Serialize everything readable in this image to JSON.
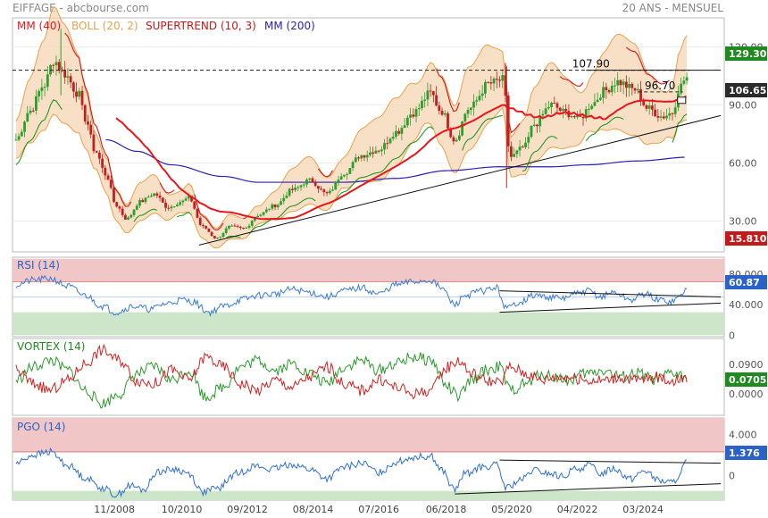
{
  "header": {
    "title": "EIFFAGE - abcbourse.com",
    "period": "20 ANS - MENSUEL"
  },
  "colors": {
    "mm40": "#e8161b",
    "boll": "#e8a048",
    "bollFill": "#f5d6b4",
    "supertrend": "#d4151b",
    "supertrendUp": "#229922",
    "mm200": "#2a1fb5",
    "up": "#2ca02c",
    "down": "#c22020",
    "rsi": "#3a7bd5",
    "pgo": "#2f6fd0",
    "vortexPlus": "#2a9a2a",
    "vortexMinus": "#d42020",
    "overZone": "#f1c6c6",
    "underZone": "#cde5c9",
    "tagGreen": "#1f8a1f",
    "tagRed": "#c41a1a",
    "tagBlue": "#2b62c8",
    "tagDark": "#2b2b2b"
  },
  "legend": {
    "mm40": "MM (40)",
    "boll": "BOLL (20, 2)",
    "supertrend": "SUPERTREND (10, 3)",
    "mm200": "MM (200)"
  },
  "chart_data": [
    {
      "type": "candlestick",
      "id": "price",
      "ylim": [
        14,
        135
      ],
      "yticks": [
        30,
        60,
        90,
        120
      ],
      "x_labels": [
        "11/2008",
        "10/2010",
        "09/2012",
        "08/2014",
        "07/2016",
        "06/2018",
        "05/2020",
        "04/2022",
        "03/2024"
      ],
      "x_range": [
        2005.9,
        2026.5
      ],
      "badges": {
        "high": "129.30",
        "last": "106.65",
        "low": "15.810"
      },
      "annotations": [
        {
          "text": "107.90",
          "x": 2022.1,
          "y": 107.9
        },
        {
          "text": "96.70",
          "x": 2024.2,
          "y": 96.7
        }
      ],
      "levels": [
        {
          "y": 107.9,
          "style": "dashed",
          "x_from": 2005.9,
          "x_to": 2025.5
        },
        {
          "y": 96.7,
          "style": "dashed",
          "x_from": 2024.0,
          "x_to": 2025.3
        }
      ],
      "trendlines": [
        {
          "from": [
            2011.3,
            17.5
          ],
          "to": [
            2026.4,
            84.5
          ]
        },
        {
          "from": [
            2022.5,
            107.9
          ],
          "to": [
            2026.4,
            107.9
          ]
        }
      ],
      "anchors": [
        [
          2006.0,
          72
        ],
        [
          2006.4,
          87
        ],
        [
          2006.8,
          100
        ],
        [
          2007.1,
          113
        ],
        [
          2007.4,
          106
        ],
        [
          2007.8,
          96
        ],
        [
          2008.0,
          83
        ],
        [
          2008.3,
          66
        ],
        [
          2008.6,
          54
        ],
        [
          2008.9,
          38
        ],
        [
          2009.2,
          31
        ],
        [
          2009.6,
          40
        ],
        [
          2010.0,
          44
        ],
        [
          2010.4,
          37
        ],
        [
          2010.8,
          40
        ],
        [
          2011.0,
          42
        ],
        [
          2011.4,
          27
        ],
        [
          2011.8,
          21
        ],
        [
          2012.2,
          27
        ],
        [
          2012.6,
          26
        ],
        [
          2013.0,
          33
        ],
        [
          2013.5,
          38
        ],
        [
          2014.0,
          46
        ],
        [
          2014.5,
          51
        ],
        [
          2015.0,
          44
        ],
        [
          2015.5,
          55
        ],
        [
          2016.0,
          64
        ],
        [
          2016.5,
          67
        ],
        [
          2017.0,
          76
        ],
        [
          2017.5,
          86
        ],
        [
          2018.0,
          96
        ],
        [
          2018.3,
          87
        ],
        [
          2018.7,
          72
        ],
        [
          2019.1,
          88
        ],
        [
          2019.7,
          101
        ],
        [
          2020.1,
          103
        ],
        [
          2020.3,
          63
        ],
        [
          2020.7,
          68
        ],
        [
          2021.0,
          80
        ],
        [
          2021.5,
          90
        ],
        [
          2021.9,
          86
        ],
        [
          2022.3,
          83
        ],
        [
          2022.7,
          91
        ],
        [
          2023.0,
          97
        ],
        [
          2023.4,
          102
        ],
        [
          2023.9,
          98
        ],
        [
          2024.3,
          88
        ],
        [
          2024.7,
          84
        ],
        [
          2025.0,
          86
        ],
        [
          2025.2,
          99
        ],
        [
          2025.4,
          104
        ]
      ],
      "bands_width": 0.19,
      "mm40_offset": 0,
      "mm200_anchors": [
        [
          2008.6,
          72
        ],
        [
          2009.5,
          66
        ],
        [
          2010.5,
          59
        ],
        [
          2012.0,
          53
        ],
        [
          2013.0,
          50
        ],
        [
          2014.0,
          50
        ],
        [
          2015.5,
          50
        ],
        [
          2017.0,
          52
        ],
        [
          2018.5,
          56
        ],
        [
          2020.0,
          58
        ],
        [
          2021.5,
          58
        ],
        [
          2022.5,
          59
        ],
        [
          2024.0,
          61
        ],
        [
          2025.5,
          63
        ]
      ]
    },
    {
      "type": "line",
      "id": "rsi",
      "title": "RSI (14)",
      "ylim": [
        -2,
        102
      ],
      "yticks": [
        0,
        40,
        80
      ],
      "zones": {
        "over": [
          70,
          100
        ],
        "under": [
          0,
          30
        ]
      },
      "midline": 50,
      "badge": "60.87",
      "trendlines": [
        {
          "from": [
            2020.0,
            58
          ],
          "to": [
            2026.4,
            50
          ]
        },
        {
          "from": [
            2020.0,
            30
          ],
          "to": [
            2026.4,
            42
          ]
        }
      ],
      "anchors": [
        [
          2006.0,
          66
        ],
        [
          2006.5,
          72
        ],
        [
          2007.0,
          74
        ],
        [
          2007.5,
          64
        ],
        [
          2008.0,
          52
        ],
        [
          2008.5,
          38
        ],
        [
          2008.9,
          30
        ],
        [
          2009.4,
          38
        ],
        [
          2009.9,
          34
        ],
        [
          2010.3,
          41
        ],
        [
          2010.8,
          46
        ],
        [
          2011.1,
          44
        ],
        [
          2011.6,
          30
        ],
        [
          2012.0,
          38
        ],
        [
          2012.6,
          47
        ],
        [
          2013.0,
          52
        ],
        [
          2013.5,
          54
        ],
        [
          2014.0,
          60
        ],
        [
          2014.5,
          56
        ],
        [
          2015.0,
          50
        ],
        [
          2015.5,
          58
        ],
        [
          2016.0,
          62
        ],
        [
          2016.5,
          54
        ],
        [
          2017.0,
          66
        ],
        [
          2017.5,
          70
        ],
        [
          2018.0,
          72
        ],
        [
          2018.3,
          62
        ],
        [
          2018.7,
          40
        ],
        [
          2019.0,
          52
        ],
        [
          2019.5,
          58
        ],
        [
          2019.9,
          62
        ],
        [
          2020.2,
          35
        ],
        [
          2020.6,
          44
        ],
        [
          2021.0,
          52
        ],
        [
          2021.4,
          50
        ],
        [
          2021.8,
          48
        ],
        [
          2022.2,
          54
        ],
        [
          2022.6,
          58
        ],
        [
          2022.9,
          50
        ],
        [
          2023.3,
          56
        ],
        [
          2023.8,
          46
        ],
        [
          2024.2,
          54
        ],
        [
          2024.6,
          46
        ],
        [
          2025.0,
          44
        ],
        [
          2025.2,
          50
        ],
        [
          2025.4,
          61
        ]
      ]
    },
    {
      "type": "line",
      "id": "vortex",
      "title": "VORTEX (14)",
      "yticks_labels": [
        "0.0900",
        "0.0705"
      ],
      "badge": "0.0705",
      "ylim": [
        -1.15,
        1.15
      ],
      "plus_anchors": [
        [
          2006.0,
          -0.1
        ],
        [
          2006.5,
          0.3
        ],
        [
          2007.0,
          0.5
        ],
        [
          2007.5,
          0.2
        ],
        [
          2008.0,
          -0.4
        ],
        [
          2008.5,
          -0.8
        ],
        [
          2009.0,
          -0.5
        ],
        [
          2009.5,
          0.1
        ],
        [
          2010.0,
          0.3
        ],
        [
          2010.5,
          -0.1
        ],
        [
          2011.0,
          0.2
        ],
        [
          2011.5,
          -0.6
        ],
        [
          2012.0,
          -0.3
        ],
        [
          2012.5,
          0.3
        ],
        [
          2013.0,
          0.5
        ],
        [
          2013.5,
          0.2
        ],
        [
          2014.0,
          0.4
        ],
        [
          2014.5,
          0.1
        ],
        [
          2015.0,
          -0.2
        ],
        [
          2015.5,
          0.3
        ],
        [
          2016.0,
          0.5
        ],
        [
          2016.5,
          0.2
        ],
        [
          2017.0,
          0.4
        ],
        [
          2017.5,
          0.6
        ],
        [
          2018.0,
          0.5
        ],
        [
          2018.5,
          -0.3
        ],
        [
          2018.8,
          -0.6
        ],
        [
          2019.2,
          -0.1
        ],
        [
          2019.6,
          0.2
        ],
        [
          2020.0,
          0.3
        ],
        [
          2020.3,
          -0.4
        ],
        [
          2020.8,
          -0.2
        ],
        [
          2021.2,
          0.1
        ],
        [
          2021.6,
          0.0
        ],
        [
          2022.0,
          -0.1
        ],
        [
          2022.5,
          0.1
        ],
        [
          2023.0,
          0.2
        ],
        [
          2023.5,
          0.0
        ],
        [
          2024.0,
          0.1
        ],
        [
          2024.5,
          -0.1
        ],
        [
          2025.0,
          0.1
        ],
        [
          2025.4,
          0.0
        ]
      ],
      "minus_anchors": [
        [
          2006.0,
          0.2
        ],
        [
          2006.5,
          -0.2
        ],
        [
          2007.0,
          -0.4
        ],
        [
          2007.5,
          -0.1
        ],
        [
          2008.0,
          0.4
        ],
        [
          2008.5,
          0.8
        ],
        [
          2009.0,
          0.5
        ],
        [
          2009.5,
          -0.1
        ],
        [
          2010.0,
          -0.2
        ],
        [
          2010.5,
          0.2
        ],
        [
          2011.0,
          -0.1
        ],
        [
          2011.5,
          0.6
        ],
        [
          2012.0,
          0.3
        ],
        [
          2012.5,
          -0.2
        ],
        [
          2013.0,
          -0.4
        ],
        [
          2013.5,
          -0.1
        ],
        [
          2014.0,
          -0.3
        ],
        [
          2014.5,
          0.0
        ],
        [
          2015.0,
          0.3
        ],
        [
          2015.5,
          -0.2
        ],
        [
          2016.0,
          -0.4
        ],
        [
          2016.5,
          -0.1
        ],
        [
          2017.0,
          -0.3
        ],
        [
          2017.5,
          -0.5
        ],
        [
          2018.0,
          -0.4
        ],
        [
          2018.5,
          0.3
        ],
        [
          2018.8,
          0.5
        ],
        [
          2019.2,
          0.1
        ],
        [
          2019.6,
          -0.1
        ],
        [
          2020.0,
          -0.2
        ],
        [
          2020.3,
          0.3
        ],
        [
          2020.8,
          0.1
        ],
        [
          2021.2,
          -0.1
        ],
        [
          2021.6,
          0.0
        ],
        [
          2022.0,
          0.0
        ],
        [
          2022.5,
          -0.1
        ],
        [
          2023.0,
          -0.1
        ],
        [
          2023.5,
          0.0
        ],
        [
          2024.0,
          -0.1
        ],
        [
          2024.5,
          0.0
        ],
        [
          2025.0,
          -0.1
        ],
        [
          2025.4,
          0.0
        ]
      ]
    },
    {
      "type": "line",
      "id": "pgo",
      "title": "PGO (14)",
      "ylim": [
        -2.4,
        5.6
      ],
      "yticks": [
        0,
        4
      ],
      "ytick_labels": [
        "0",
        "4.000"
      ],
      "zones": {
        "over": [
          2.3,
          5.6
        ],
        "under": [
          -2.4,
          -1.5
        ]
      },
      "badge": "1.376",
      "trendlines": [
        {
          "from": [
            2020.0,
            1.5
          ],
          "to": [
            2026.4,
            1.2
          ]
        },
        {
          "from": [
            2018.7,
            -1.8
          ],
          "to": [
            2026.4,
            -0.8
          ]
        }
      ],
      "anchors": [
        [
          2006.0,
          1.2
        ],
        [
          2006.5,
          2.0
        ],
        [
          2007.0,
          2.3
        ],
        [
          2007.5,
          1.0
        ],
        [
          2008.0,
          -0.2
        ],
        [
          2008.5,
          -1.2
        ],
        [
          2008.9,
          -1.9
        ],
        [
          2009.3,
          -1.0
        ],
        [
          2009.7,
          -1.4
        ],
        [
          2010.1,
          0.4
        ],
        [
          2010.6,
          0.6
        ],
        [
          2011.0,
          0.2
        ],
        [
          2011.4,
          -1.6
        ],
        [
          2011.8,
          -1.3
        ],
        [
          2012.4,
          0.2
        ],
        [
          2012.9,
          0.9
        ],
        [
          2013.4,
          0.6
        ],
        [
          2014.0,
          1.1
        ],
        [
          2014.5,
          0.6
        ],
        [
          2015.0,
          -0.3
        ],
        [
          2015.5,
          0.8
        ],
        [
          2016.0,
          1.2
        ],
        [
          2016.5,
          0.3
        ],
        [
          2017.0,
          1.3
        ],
        [
          2017.5,
          1.8
        ],
        [
          2018.0,
          1.9
        ],
        [
          2018.3,
          0.6
        ],
        [
          2018.7,
          -1.4
        ],
        [
          2019.0,
          0.2
        ],
        [
          2019.5,
          0.8
        ],
        [
          2019.9,
          1.0
        ],
        [
          2020.2,
          -1.2
        ],
        [
          2020.6,
          -0.5
        ],
        [
          2021.0,
          0.5
        ],
        [
          2021.4,
          0.2
        ],
        [
          2021.8,
          -0.1
        ],
        [
          2022.2,
          0.6
        ],
        [
          2022.6,
          1.0
        ],
        [
          2022.9,
          0.2
        ],
        [
          2023.3,
          0.7
        ],
        [
          2023.8,
          -0.3
        ],
        [
          2024.2,
          0.5
        ],
        [
          2024.6,
          -0.5
        ],
        [
          2025.0,
          -0.7
        ],
        [
          2025.2,
          0.0
        ],
        [
          2025.4,
          1.38
        ]
      ]
    }
  ]
}
